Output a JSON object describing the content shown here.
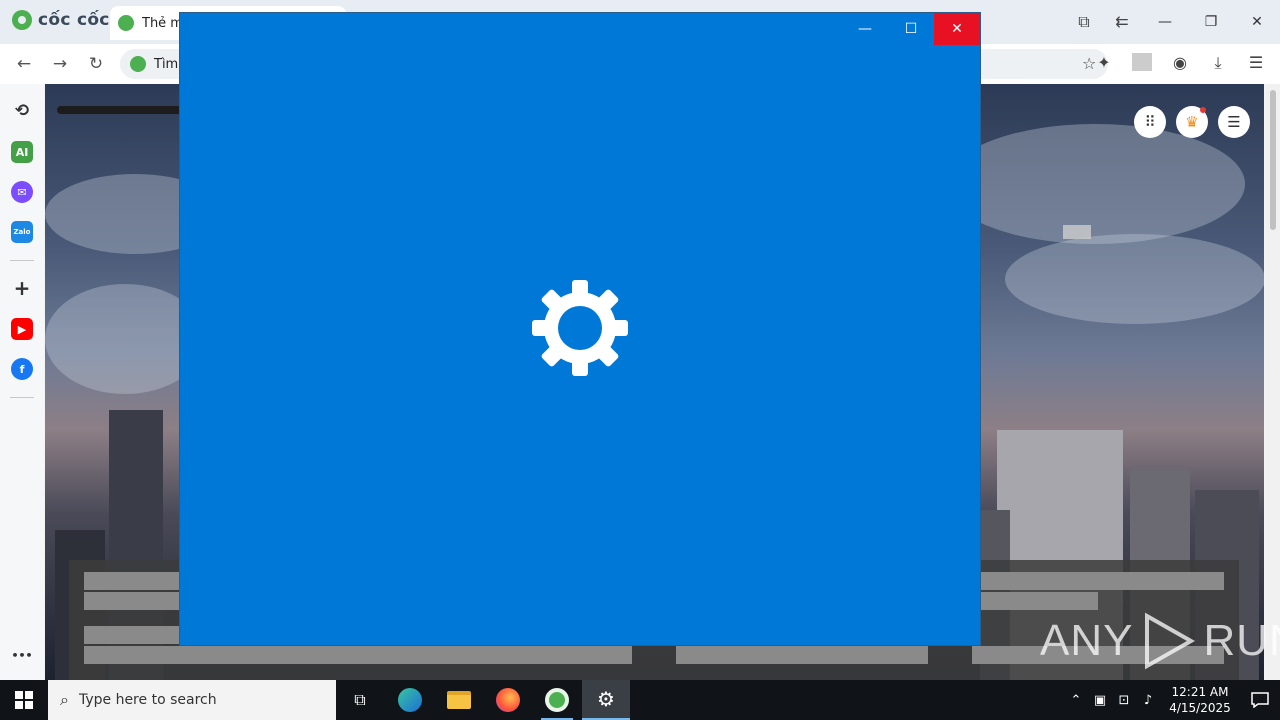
{
  "browser": {
    "brand": "cốc cốc",
    "tab_title": "Thẻ m",
    "address_text": "Tìm",
    "window_controls": [
      "minimize",
      "restore",
      "close"
    ]
  },
  "sidebar": {
    "items": [
      "history-icon",
      "ai-icon",
      "messenger-icon",
      "zalo-icon",
      "add-icon",
      "youtube-icon",
      "facebook-icon",
      "more-icon"
    ],
    "ai_label": "AI",
    "zalo_label": "Zalo",
    "more_label": "•••"
  },
  "settings_window": {
    "icon": "gear-icon",
    "accent": "#0078d7",
    "close_color": "#e81123"
  },
  "watermark": {
    "text_left": "ANY",
    "text_right": "RUN"
  },
  "taskbar": {
    "search_placeholder": "Type here to search",
    "time": "12:21 AM",
    "date": "4/15/2025",
    "apps": [
      "task-view",
      "edge",
      "file-explorer",
      "firefox",
      "coccoc",
      "settings"
    ]
  }
}
